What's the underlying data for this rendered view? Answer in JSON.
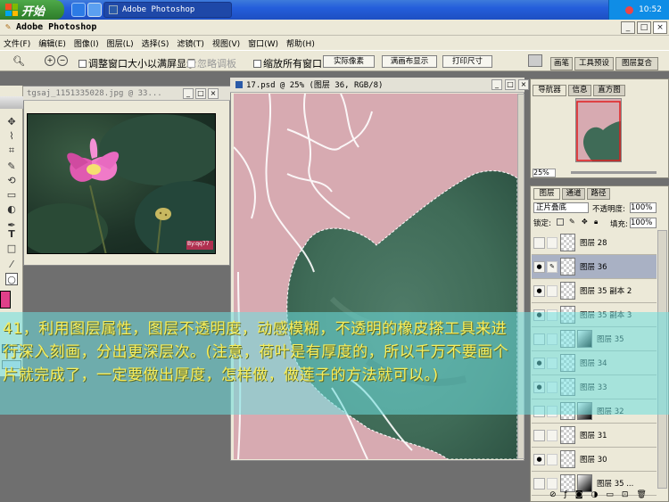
{
  "taskbar": {
    "start_label": "开始",
    "task_label": "Adobe Photoshop",
    "clock": "10:52"
  },
  "app": {
    "title": "Adobe Photoshop",
    "min": "_",
    "max": "□",
    "close": "×"
  },
  "menu": [
    "文件(F)",
    "编辑(E)",
    "图像(I)",
    "图层(L)",
    "选择(S)",
    "滤镜(T)",
    "视图(V)",
    "窗口(W)",
    "帮助(H)"
  ],
  "options": {
    "resize_window": "调整窗口大小以满屏显示",
    "ignore_palettes": "忽略调板",
    "zoom_all": "缩放所有窗口",
    "actual_pixels": "实际像素",
    "fit_screen": "满画布显示",
    "print_size": "打印尺寸",
    "tabs": [
      "画笔",
      "工具预设",
      "图层复合"
    ]
  },
  "doc1": {
    "title": "tgsaj_1151335028.jpg @ 33...",
    "watermark": "By:qq77"
  },
  "doc2": {
    "title": "17.psd @ 25% (图层 36, RGB/8)"
  },
  "navigator": {
    "tabs": [
      "导航器",
      "信息",
      "直方图"
    ],
    "zoom": "25%"
  },
  "layers_panel": {
    "tabs": [
      "图层",
      "通道",
      "路径"
    ],
    "blend_mode": "正片叠底",
    "opacity_label": "不透明度:",
    "opacity_value": "100%",
    "lock_label": "锁定:",
    "fill_label": "填充:",
    "fill_value": "100%",
    "layers": [
      {
        "name": "图层 28",
        "visible": false,
        "mask": false,
        "selected": false
      },
      {
        "name": "图层 36",
        "visible": true,
        "mask": false,
        "selected": true
      },
      {
        "name": "图层 35 副本 2",
        "visible": true,
        "mask": false,
        "selected": false
      },
      {
        "name": "图层 35 副本 3",
        "visible": true,
        "mask": false,
        "selected": false
      },
      {
        "name": "图层 35",
        "visible": false,
        "mask": true,
        "selected": false
      },
      {
        "name": "图层 34",
        "visible": true,
        "mask": false,
        "selected": false
      },
      {
        "name": "图层 33",
        "visible": true,
        "mask": false,
        "selected": false
      },
      {
        "name": "图层 32",
        "visible": false,
        "mask": true,
        "selected": false
      },
      {
        "name": "图层 31",
        "visible": false,
        "mask": false,
        "selected": false
      },
      {
        "name": "图层 30",
        "visible": true,
        "mask": false,
        "selected": false
      },
      {
        "name": "图层 35 ...",
        "visible": false,
        "mask": true,
        "selected": false
      }
    ]
  },
  "caption": "41，利用图层属性，图层不透明度，动感模糊，不透明的橡皮搽工具来进行深入刻画，分出更深层次。(注意，荷叶是有厚度的，所以千万不要画个片就完成了，一定要做出厚度，怎样做，做莲子的方法就可以。)",
  "colors": {
    "canvas_pink": "#d7aab1",
    "leaf_green": "#3f6b57",
    "foreground_swatch": "#e0408a",
    "caption_text": "#f7ee5c"
  }
}
